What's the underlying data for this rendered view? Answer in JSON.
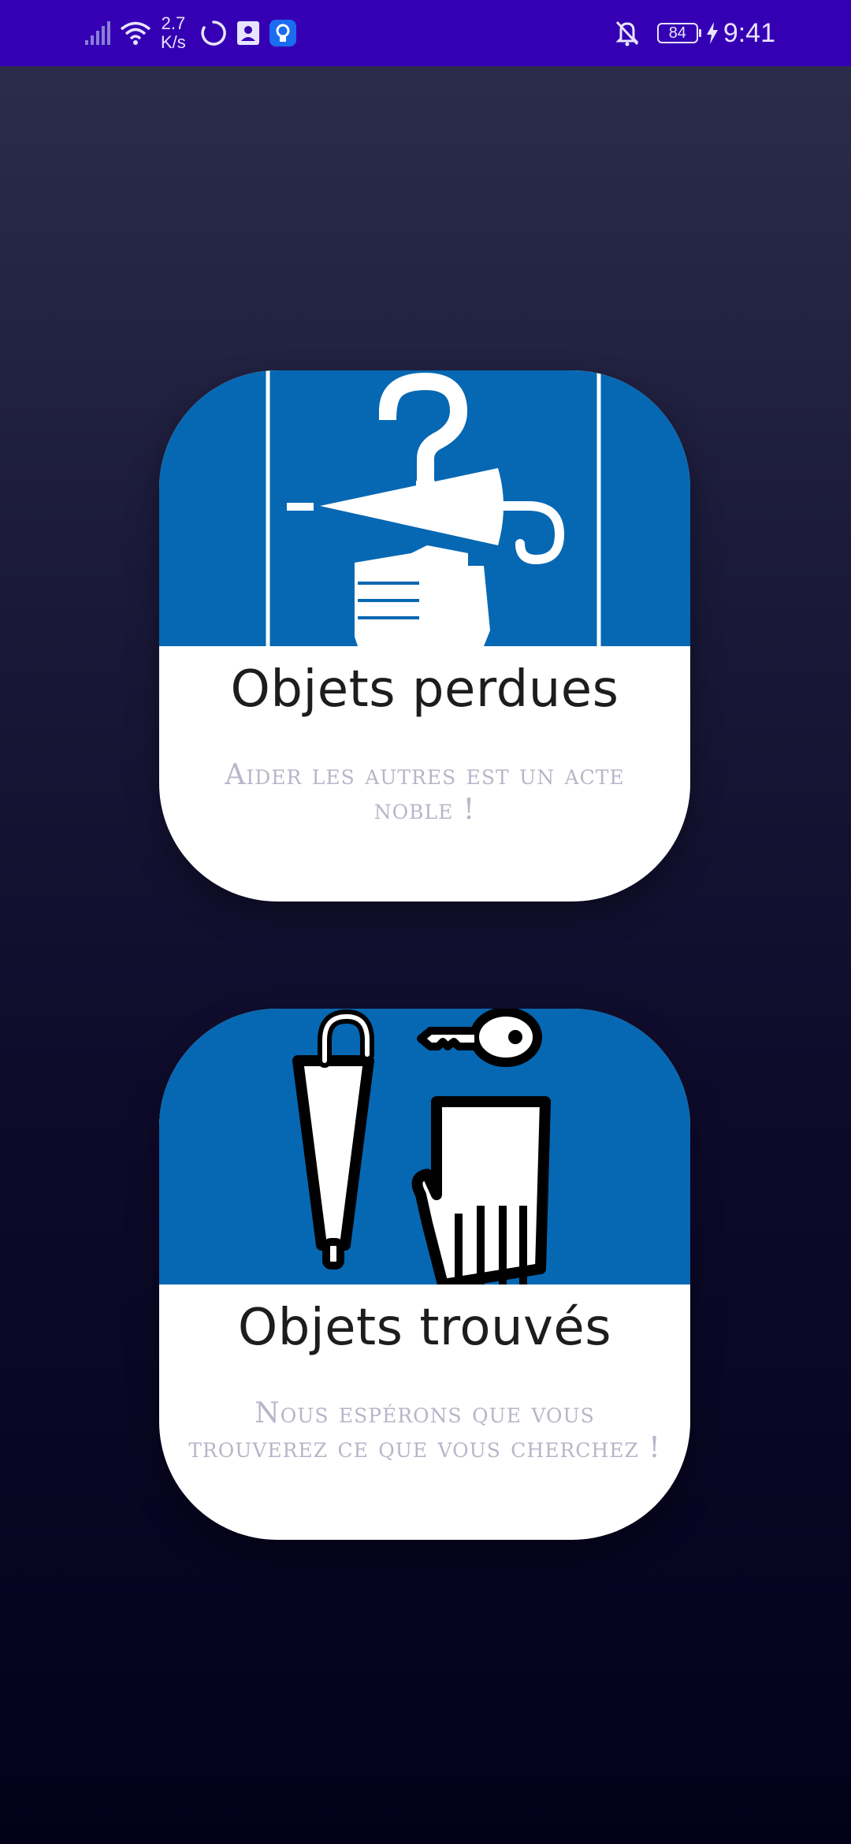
{
  "status_bar": {
    "speed_value": "2.7",
    "speed_unit": "K/s",
    "battery": "84",
    "time": "9:41",
    "icons": [
      "signal-icon",
      "wifi-icon",
      "sync-icon",
      "contact-card-icon",
      "lightbulb-icon",
      "bell-off-icon",
      "battery-icon",
      "charging-icon"
    ],
    "background_color": "#3500b3"
  },
  "cards": {
    "lost": {
      "title": "Objets perdues",
      "subtitle": "Aider les autres est un acte noble !",
      "illustration": "lost-items-umbrella-question-icon"
    },
    "found": {
      "title": "Objets trouvés",
      "subtitle": "Nous espérons que vous trouverez ce que vous cherchez !",
      "illustration": "found-items-umbrella-key-glove-icon"
    }
  },
  "colors": {
    "card_header": "#0668b3",
    "title_text": "#1d1d1d",
    "subtitle_text": "#b7b6c9"
  }
}
